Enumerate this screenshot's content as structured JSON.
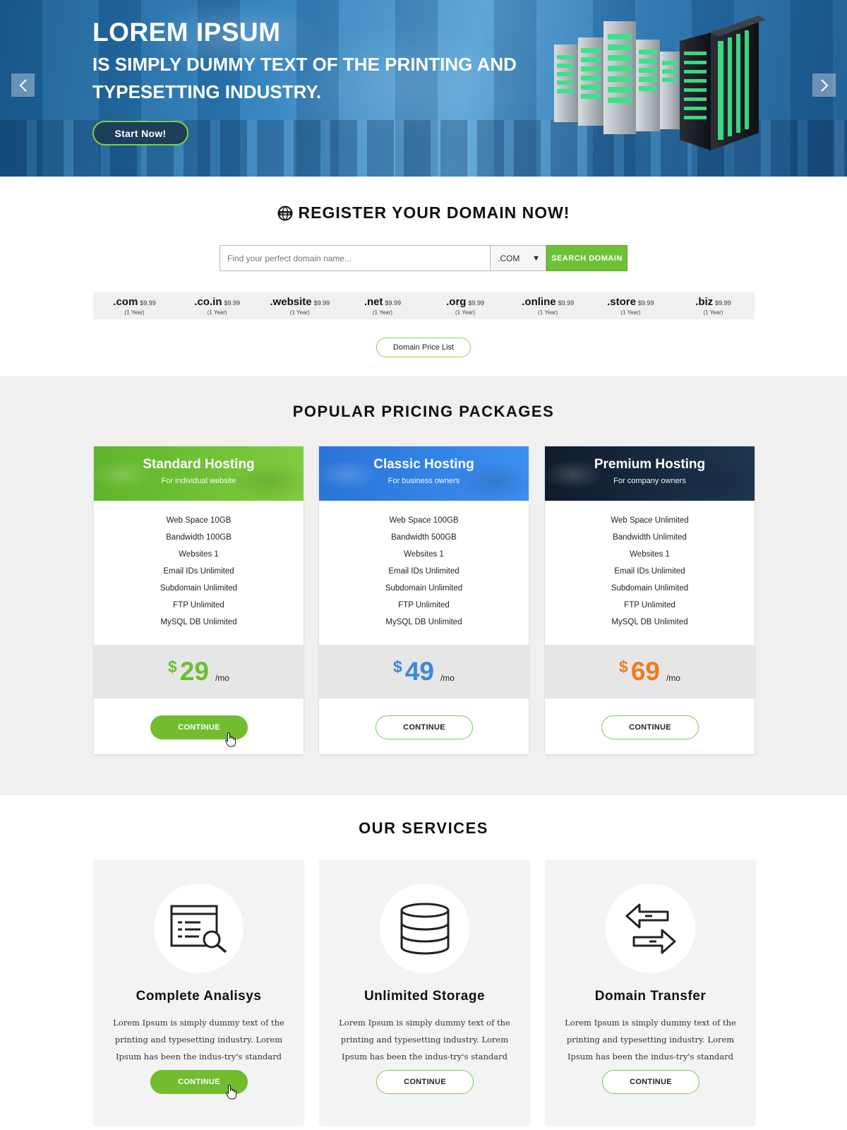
{
  "hero": {
    "title": "LOREM IPSUM",
    "subtitle": "IS SIMPLY DUMMY TEXT OF THE PRINTING AND TYPESETTING INDUSTRY.",
    "cta_label": "Start Now!",
    "arrow_prev_icon": "chevron-left-icon",
    "arrow_next_icon": "chevron-right-icon"
  },
  "domain": {
    "heading": "REGISTER YOUR DOMAIN NOW!",
    "heading_icon": "www-globe-icon",
    "search_placeholder": "Find your perfect domain name...",
    "tld_selected": ".COM",
    "search_button": "SEARCH DOMAIN",
    "tlds": [
      {
        "name": ".com",
        "price": "$9.99",
        "period": "(1 Year)"
      },
      {
        "name": ".co.in",
        "price": "$9.99",
        "period": "(1 Year)"
      },
      {
        "name": ".website",
        "price": "$9.99",
        "period": "(1 Year)"
      },
      {
        "name": ".net",
        "price": "$9.99",
        "period": "(1 Year)"
      },
      {
        "name": ".org",
        "price": "$9.99",
        "period": "(1 Year)"
      },
      {
        "name": ".online",
        "price": "$9.99",
        "period": "(1 Year)"
      },
      {
        "name": ".store",
        "price": "$9.99",
        "period": "(1 Year)"
      },
      {
        "name": ".biz",
        "price": "$9.99",
        "period": "(1 Year)"
      }
    ],
    "price_list_button": "Domain Price List"
  },
  "pricing": {
    "heading": "POPULAR PRICING PACKAGES",
    "plans": [
      {
        "title": "Standard Hosting",
        "subtitle": "For individual website",
        "color": "#6cbf2e",
        "features": [
          "Web Space 10GB",
          "Bandwidth 100GB",
          "Websites 1",
          "Email IDs Unlimited",
          "Subdomain Unlimited",
          "FTP Unlimited",
          "MySQL DB Unlimited"
        ],
        "currency": "$",
        "price": "29",
        "period": "/mo",
        "price_color": "#6cbf2e",
        "button": "CONTINUE"
      },
      {
        "title": "Classic Hosting",
        "subtitle": "For business owners",
        "color": "#2f7fe0",
        "features": [
          "Web Space 100GB",
          "Bandwidth 500GB",
          "Websites 1",
          "Email IDs Unlimited",
          "Subdomain Unlimited",
          "FTP Unlimited",
          "MySQL DB Unlimited"
        ],
        "currency": "$",
        "price": "49",
        "period": "/mo",
        "price_color": "#3b86e0",
        "button": "CONTINUE"
      },
      {
        "title": "Premium Hosting",
        "subtitle": "For company owners",
        "color": "#14253b",
        "features": [
          "Web Space Unlimited",
          "Bandwidth Unlimited",
          "Websites 1",
          "Email IDs Unlimited",
          "Subdomain Unlimited",
          "FTP Unlimited",
          "MySQL DB Unlimited"
        ],
        "currency": "$",
        "price": "69",
        "period": "/mo",
        "price_color": "#f07b1a",
        "button": "CONTINUE"
      }
    ]
  },
  "services": {
    "heading": "OUR SERVICES",
    "items": [
      {
        "title": "Complete Analisys",
        "icon": "analysis-report-icon",
        "description": "Lorem Ipsum is simply dummy text of the printing and typesetting industry. Lorem Ipsum has been the indus-try's standard dummy.",
        "button": "CONTINUE"
      },
      {
        "title": "Unlimited Storage",
        "icon": "database-icon",
        "description": "Lorem Ipsum is simply dummy text of the printing and typesetting industry. Lorem Ipsum has been the indus-try's standard dummy.",
        "button": "CONTINUE"
      },
      {
        "title": "Domain Transfer",
        "icon": "transfer-arrows-icon",
        "description": "Lorem Ipsum is simply dummy text of the printing and typesetting industry. Lorem Ipsum has been the indus-try's standard dummy.",
        "button": "CONTINUE"
      }
    ]
  },
  "colors": {
    "accent_green": "#6ec135",
    "hero_blue": "#2f7fbc"
  }
}
